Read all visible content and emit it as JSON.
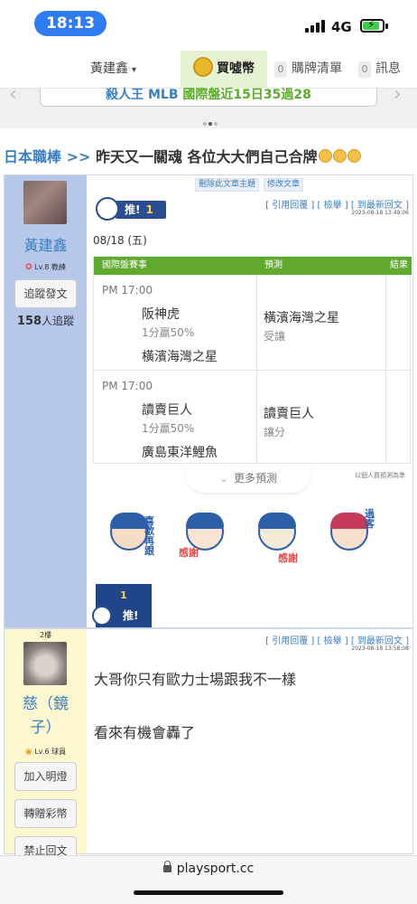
{
  "status_bar": {
    "time": "18:13",
    "network": "4G"
  },
  "nav": {
    "user": "黃建鑫",
    "buy": "買噓幣",
    "items": [
      {
        "count": "0",
        "label": "購牌清單"
      },
      {
        "count": "0",
        "label": "訊息"
      }
    ]
  },
  "banner": {
    "text_blue": "殺人王 MLB",
    "text_green": "國際盤近15日35過28"
  },
  "thread": {
    "forum": "日本職棒",
    "separator": ">>",
    "title": "昨天又一關魂 各位大大們自己合牌"
  },
  "post1": {
    "edit_buttons": [
      "刪除此文章主題",
      "修改文章"
    ],
    "links": "[ 引用回覆 ]  [ 檢舉 ]  [ 到最新回文 ]",
    "timestamp": "2023-08-18 13:49:06",
    "author": {
      "name": "黃建鑫",
      "level": "Lv.8 教練",
      "follow_button": "追蹤發文",
      "followers": "158",
      "followers_suffix": "人追蹤"
    },
    "push": {
      "label": "推!",
      "count": "1"
    },
    "date": "08/18 (五)",
    "table": {
      "headers": [
        "國際盤賽事",
        "預測",
        "結果"
      ],
      "games": [
        {
          "time": "PM 17:00",
          "home": "阪神虎",
          "line": "1分贏50%",
          "away": "橫濱海灣之星",
          "pick": "橫濱海灣之星",
          "pick_note": "受讓"
        },
        {
          "time": "PM 17:00",
          "home": "讀賣巨人",
          "line": "1分贏50%",
          "away": "廣島東洋鯉魚",
          "pick": "讀賣巨人",
          "pick_note": "讓分"
        }
      ]
    },
    "more_button": "更多預測",
    "note": "以個人買預測為準",
    "stickers": [
      {
        "icon": "sticker-ask-icon",
        "text": "喜歡再跟"
      },
      {
        "icon": "sticker-thanks-cry-icon",
        "text": "感謝"
      },
      {
        "icon": "sticker-thanks-heart-icon",
        "text": "感謝"
      },
      {
        "icon": "sticker-pass-icon",
        "text": "過客"
      }
    ],
    "push_footer": {
      "count": "1",
      "label": "推!"
    }
  },
  "post2": {
    "floor": "2樓",
    "links": "[ 引用回覆 ]  [ 檢舉 ]  [ 到最新回文 ]",
    "timestamp": "2023-08-18 13:58:08",
    "author": {
      "name": "慈（鏡子）",
      "level": "Lv.6 球員",
      "buttons": [
        "加入明燈",
        "轉贈彩幣",
        "禁止回文"
      ]
    },
    "lines": [
      "大哥你只有歐力士場跟我不一樣",
      "看來有機會轟了"
    ]
  },
  "url_bar": {
    "url": "playsport.cc"
  },
  "colors": {
    "accent_blue": "#3a7fc1",
    "header_green": "#5faa2e",
    "pill_blue": "#2f7bf2"
  }
}
